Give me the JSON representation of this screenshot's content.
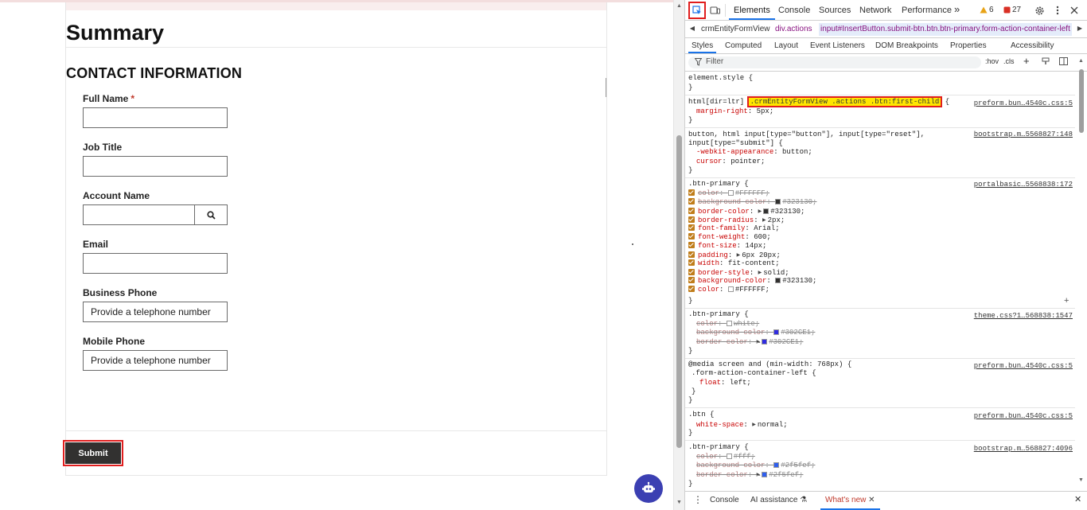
{
  "form": {
    "heading": "Summary",
    "section_title": "CONTACT INFORMATION",
    "fields": [
      {
        "label": "Full Name",
        "required_mark": "*",
        "value": "",
        "placeholder": ""
      },
      {
        "label": "Job Title",
        "value": "",
        "placeholder": ""
      },
      {
        "label": "Account Name",
        "value": "",
        "placeholder": ""
      },
      {
        "label": "Email",
        "value": "",
        "placeholder": ""
      },
      {
        "label": "Business Phone",
        "value": "",
        "placeholder": "Provide a telephone number"
      },
      {
        "label": "Mobile Phone",
        "value": "",
        "placeholder": "Provide a telephone number"
      }
    ],
    "submit_label": "Submit",
    "highlight_color": "#E01E1E",
    "button_color": "#323130"
  },
  "devtools": {
    "tabs": [
      "Elements",
      "Console",
      "Sources",
      "Network",
      "Performance"
    ],
    "active_tab": "Elements",
    "more_tabs": "»",
    "warnings_count": "6",
    "errors_count": "27",
    "breadcrumbs": [
      "crmEntityFormView",
      "div.actions",
      "input#InsertButton.submit-btn.btn.btn-primary.form-action-container-left"
    ],
    "subtabs": [
      "Styles",
      "Computed",
      "Layout",
      "Event Listeners",
      "DOM Breakpoints",
      "Properties",
      "Accessibility"
    ],
    "active_subtab": "Styles",
    "filter_placeholder": "Filter",
    "hov": ":hov",
    "cls": ".cls",
    "rules": {
      "element_style": {
        "selector": "element.style {",
        "close": "}"
      },
      "r1": {
        "prefix": "html[dir=ltr]",
        "highlighted": ".crmEntityFormView .actions .btn:first-child",
        "open": " {",
        "source": "preform.bun…4540c.css:5",
        "prop": "margin-right",
        "val": " 5px;",
        "close": "}"
      },
      "r2": {
        "selector_a": "button, html input[type=\"button\"], input[type=\"reset\"],",
        "selector_b": "input[type=\"submit\"] {",
        "source": "bootstrap.m…5568827:148",
        "p1": "-webkit-appearance",
        "v1": " button;",
        "p2": "cursor",
        "v2": " pointer;",
        "close": "}"
      },
      "r3": {
        "selector": ".btn-primary {",
        "source": "portalbasic…5568838:172",
        "close": "}",
        "props": [
          {
            "p": "color",
            "v": "#FFFFFF;",
            "swatch": "#FFFFFF",
            "strike": true
          },
          {
            "p": "background-color",
            "v": "#323130;",
            "swatch": "#323130",
            "strike": true
          },
          {
            "p": "border-color",
            "v": "#323130;",
            "swatch": "#323130",
            "strike": false,
            "tri": true
          },
          {
            "p": "border-radius",
            "v": "2px;",
            "strike": false,
            "tri": true
          },
          {
            "p": "font-family",
            "v": "Arial;",
            "strike": false
          },
          {
            "p": "font-weight",
            "v": "600;",
            "strike": false
          },
          {
            "p": "font-size",
            "v": "14px;",
            "strike": false
          },
          {
            "p": "padding",
            "v": "6px 20px;",
            "strike": false,
            "tri": true
          },
          {
            "p": "width",
            "v": "fit-content;",
            "strike": false
          },
          {
            "p": "border-style",
            "v": "solid;",
            "strike": false,
            "tri": true
          },
          {
            "p": "background-color",
            "v": "#323130;",
            "swatch": "#323130",
            "strike": false
          },
          {
            "p": "color",
            "v": "#FFFFFF;",
            "swatch": "#FFFFFF",
            "strike": false
          }
        ]
      },
      "r4": {
        "selector": ".btn-primary {",
        "source": "theme.css?1…568838:1547",
        "close": "}",
        "props": [
          {
            "p": "color",
            "v": "white;",
            "swatch": "#FFFFFF"
          },
          {
            "p": "background-color",
            "v": "#302CE1;",
            "swatch": "#302CE1"
          },
          {
            "p": "border-color",
            "v": "#302CE1;",
            "swatch": "#302CE1",
            "tri": true
          }
        ]
      },
      "r5": {
        "media": "@media screen and (min-width: 768px) {",
        "selector": ".form-action-container-left {",
        "source": "preform.bun…4540c.css:5",
        "prop": "float",
        "val": " left;",
        "close1": "}",
        "close2": "}"
      },
      "r6": {
        "selector": ".btn {",
        "source": "preform.bun…4540c.css:5",
        "prop": "white-space",
        "val": "normal;",
        "close": "}"
      },
      "r7": {
        "selector": ".btn-primary {",
        "source": "bootstrap.m…568827:4096",
        "props": [
          {
            "p": "color",
            "v": "#fff;",
            "swatch": "#FFFFFF"
          },
          {
            "p": "background-color",
            "v": "#2f5fef;",
            "swatch": "#2F5FEF"
          },
          {
            "p": "border-color",
            "v": "#2f5fef;",
            "swatch": "#2F5FEF",
            "tri": true
          }
        ],
        "close": "}"
      }
    },
    "drawer": {
      "console": "Console",
      "ai": "AI assistance",
      "whats_new": "What's new"
    }
  }
}
